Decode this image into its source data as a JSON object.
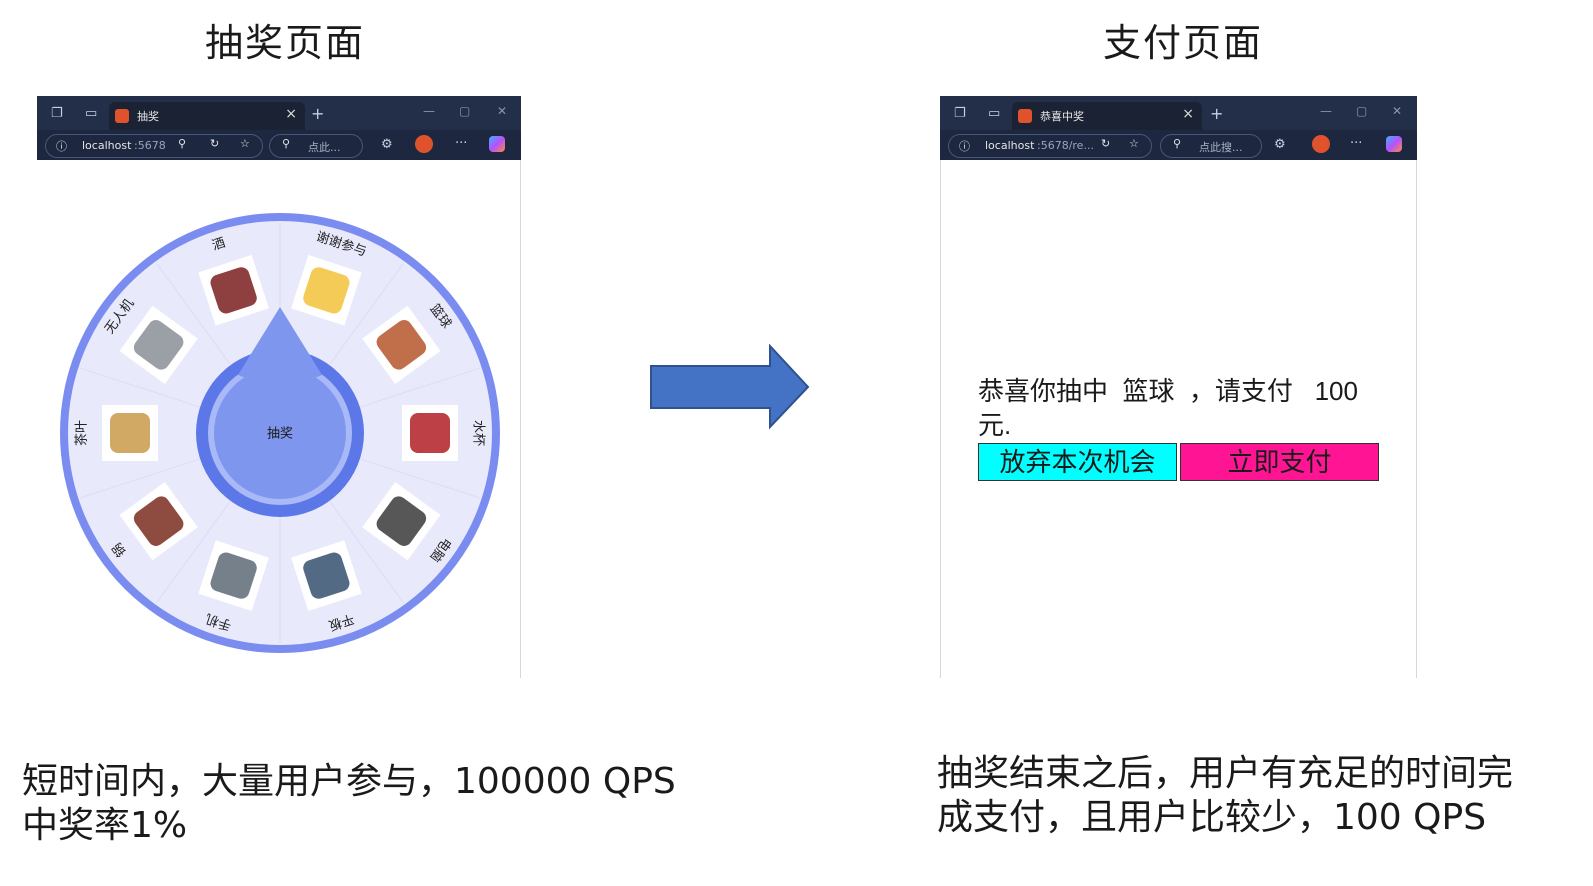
{
  "headings": {
    "left": "抽奖页面",
    "right": "支付页面"
  },
  "lottery_browser": {
    "tab_title": "抽奖",
    "address": "localhost",
    "address_port": ":5678",
    "search_placeholder": "点此..."
  },
  "wheel": {
    "center_label": "抽奖",
    "prizes": [
      "酒",
      "谢谢参与",
      "篮球",
      "水杯",
      "电脑",
      "平板",
      "手机",
      "锅",
      "茶叶",
      "无人机"
    ],
    "colors": {
      "ring": "#7b8cf0",
      "face": "#e9e9fc",
      "hub_outer": "#5c78e8",
      "hub_ring": "#a9b8f7",
      "hub_inner": "#7f96ef"
    }
  },
  "payment_browser": {
    "tab_title": "恭喜中奖",
    "address": "localhost",
    "address_port": ":5678/re...",
    "search_placeholder": "点此搜..."
  },
  "payment": {
    "message_line1": "恭喜你抽中  篮球  ，请支付   100",
    "message_line2": "元.",
    "give_up_label": "放弃本次机会",
    "pay_label": "立即支付",
    "give_up_color": "#00ffff",
    "pay_color": "#ff1493"
  },
  "captions": {
    "left_line1": "短时间内，大量用户参与，100000 QPS",
    "left_line2": "中奖率1%",
    "right_line1": "抽奖结束之后，用户有充足的时间完",
    "right_line2": "成支付，且用户比较少，100 QPS"
  },
  "arrow_color": "#4472c4"
}
